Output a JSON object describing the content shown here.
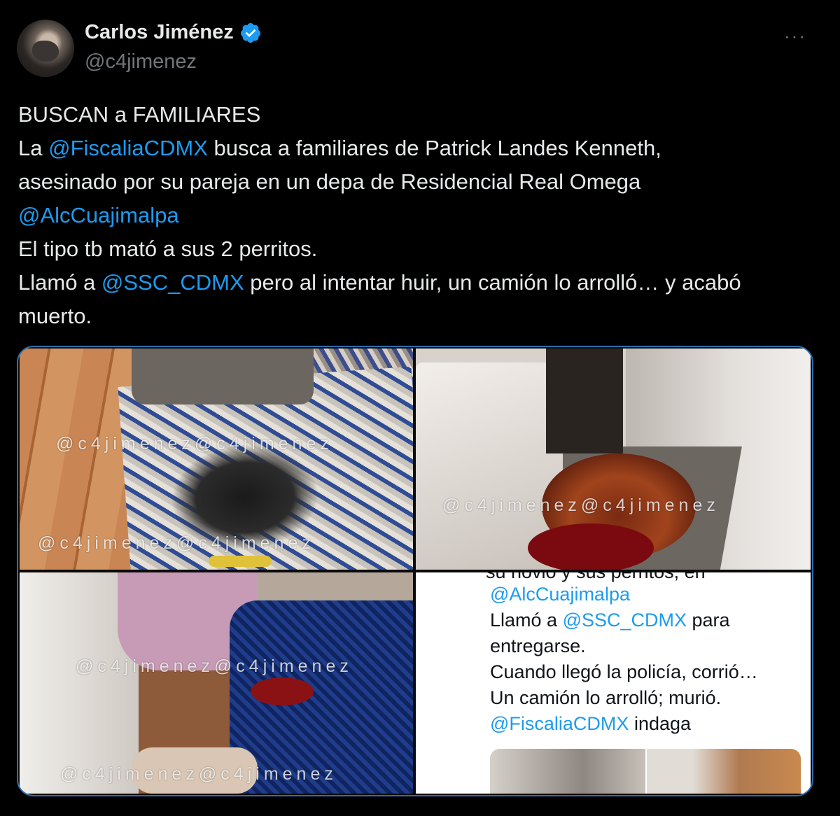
{
  "author": {
    "name": "Carlos Jiménez",
    "handle": "@c4jimenez",
    "verified_icon": "verified-badge-icon",
    "more_label": "···"
  },
  "tweet": {
    "lines": [
      [
        {
          "t": "BUSCAN a FAMILIARES",
          "m": false
        }
      ],
      [
        {
          "t": "La ",
          "m": false
        },
        {
          "t": "@FiscaliaCDMX",
          "m": true
        },
        {
          "t": " busca a familiares de Patrick Landes Kenneth,",
          "m": false
        }
      ],
      [
        {
          "t": "asesinado por su pareja en un depa de Residencial Real Omega",
          "m": false
        }
      ],
      [
        {
          "t": "@AlcCuajimalpa",
          "m": true
        }
      ],
      [
        {
          "t": "El tipo tb mató a sus 2 perritos.",
          "m": false
        }
      ],
      [
        {
          "t": "Llamó a ",
          "m": false
        },
        {
          "t": "@SSC_CDMX",
          "m": true
        },
        {
          "t": " pero al intentar huir, un camión lo arrolló… y acabó",
          "m": false
        }
      ],
      [
        {
          "t": "muerto.",
          "m": false
        }
      ]
    ]
  },
  "media": {
    "watermark": "@c4jimenez@c4jimenez",
    "quoted": {
      "cut_line": "su novio y sus perritos, en",
      "lines": [
        [
          {
            "t": "@AlcCuajimalpa",
            "m": true
          }
        ],
        [
          {
            "t": "Llamó a ",
            "m": false
          },
          {
            "t": "@SSC_CDMX",
            "m": true
          },
          {
            "t": " para",
            "m": false
          }
        ],
        [
          {
            "t": "entregarse.",
            "m": false
          }
        ],
        [
          {
            "t": "Cuando llegó la policía, corrió…",
            "m": false
          }
        ],
        [
          {
            "t": "Un camión lo arrolló; murió.",
            "m": false
          }
        ],
        [
          {
            "t": "@FiscaliaCDMX",
            "m": true
          },
          {
            "t": " indaga",
            "m": false
          }
        ]
      ]
    }
  },
  "colors": {
    "mention": "#1d9bf0",
    "background": "#000000",
    "muted": "#71767b"
  }
}
